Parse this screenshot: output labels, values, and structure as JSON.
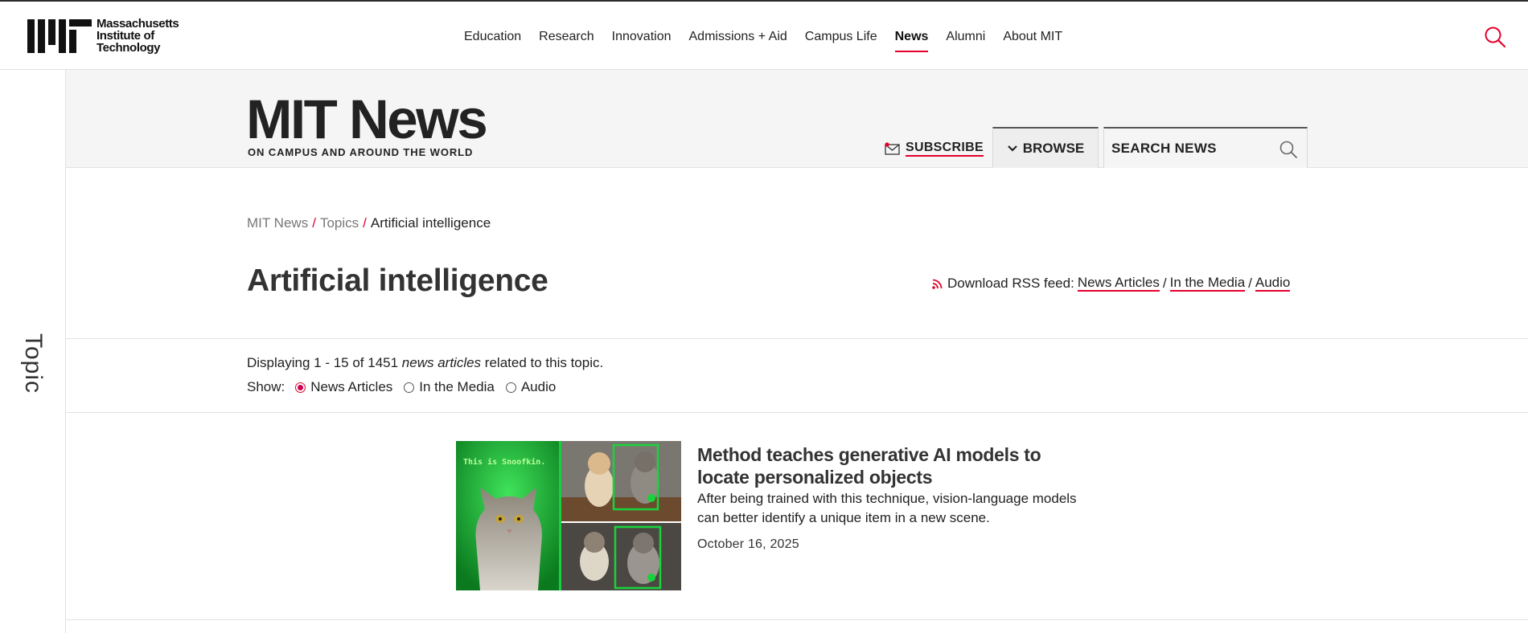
{
  "global_header": {
    "logo_lines": [
      "Massachusetts",
      "Institute of",
      "Technology"
    ],
    "nav": [
      {
        "label": "Education",
        "active": false
      },
      {
        "label": "Research",
        "active": false
      },
      {
        "label": "Innovation",
        "active": false
      },
      {
        "label": "Admissions + Aid",
        "active": false
      },
      {
        "label": "Campus Life",
        "active": false
      },
      {
        "label": "News",
        "active": true
      },
      {
        "label": "Alumni",
        "active": false
      },
      {
        "label": "About MIT",
        "active": false
      }
    ],
    "search_icon": "search-icon"
  },
  "left_rail": {
    "label": "Topic"
  },
  "masthead": {
    "title": "MIT News",
    "tagline": "ON CAMPUS AND AROUND THE WORLD",
    "subscribe_label": "SUBSCRIBE",
    "browse_label": "BROWSE",
    "search_placeholder": "SEARCH NEWS"
  },
  "page": {
    "breadcrumb": [
      {
        "label": "MIT News",
        "link": true
      },
      {
        "label": "Topics",
        "link": true
      },
      {
        "label": "Artificial intelligence",
        "link": false
      }
    ],
    "title": "Artificial intelligence",
    "rss": {
      "prefix": "Download RSS feed:",
      "links": [
        "News Articles",
        "In the Media",
        "Audio"
      ]
    },
    "display_count": {
      "before": "Displaying 1 - 15 of 1451",
      "emphasis": "news articles",
      "after": "related to this topic."
    },
    "show": {
      "label": "Show:",
      "options": [
        {
          "label": "News Articles",
          "checked": true
        },
        {
          "label": "In the Media",
          "checked": false
        },
        {
          "label": "Audio",
          "checked": false
        }
      ]
    }
  },
  "articles": [
    {
      "image_caption": "This is Snoofkin.",
      "title": "Method teaches generative AI models to locate personalized objects",
      "summary": "After being trained with this technique, vision-language models can better identify a unique item in a new scene.",
      "date": "October 16, 2025"
    }
  ],
  "colors": {
    "accent_red": "#e4002b",
    "radio_checked": "#d1004f",
    "masthead_bg": "#f5f5f5",
    "image_green": "#18c23a"
  }
}
